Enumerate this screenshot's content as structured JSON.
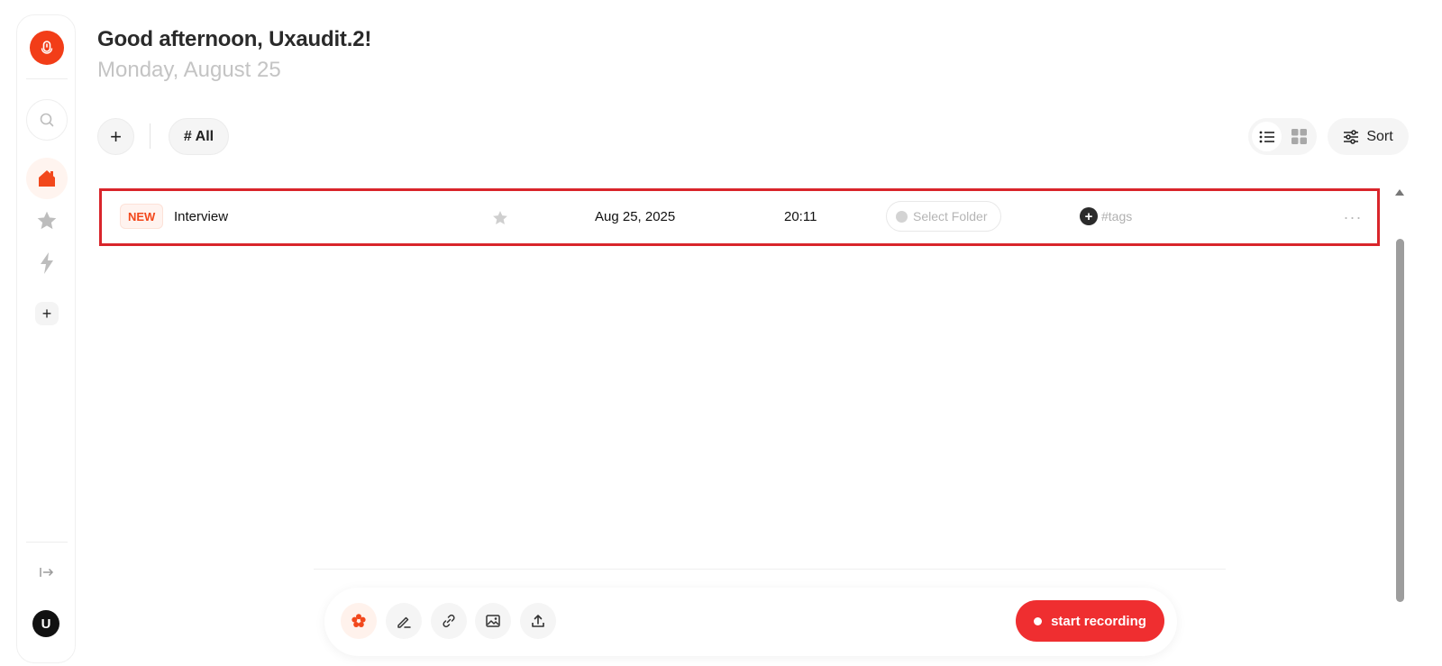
{
  "header": {
    "greeting": "Good afternoon, Uxaudit.2!",
    "date": "Monday, August 25"
  },
  "sidebar": {
    "avatar_initial": "U",
    "items": [
      {
        "icon": "search-icon"
      },
      {
        "icon": "home-icon",
        "active": true
      },
      {
        "icon": "star-icon"
      },
      {
        "icon": "lightning-icon"
      },
      {
        "icon": "plus-icon"
      }
    ],
    "add_label": "+"
  },
  "toolbar": {
    "add_label": "+",
    "filter_chip": "# All",
    "sort_label": "Sort"
  },
  "recordings": [
    {
      "badge": "NEW",
      "title": "Interview",
      "date": "Aug 25, 2025",
      "duration": "20:11",
      "folder_placeholder": "Select Folder",
      "tags_placeholder": "#tags",
      "more": "···"
    }
  ],
  "dock": {
    "tools": [
      "flower-icon",
      "pen-icon",
      "link-icon",
      "image-icon",
      "upload-icon"
    ],
    "record_label": "start recording"
  },
  "colors": {
    "accent": "#f23d18",
    "record": "#ef2e30",
    "highlight_border": "#d9252b"
  }
}
